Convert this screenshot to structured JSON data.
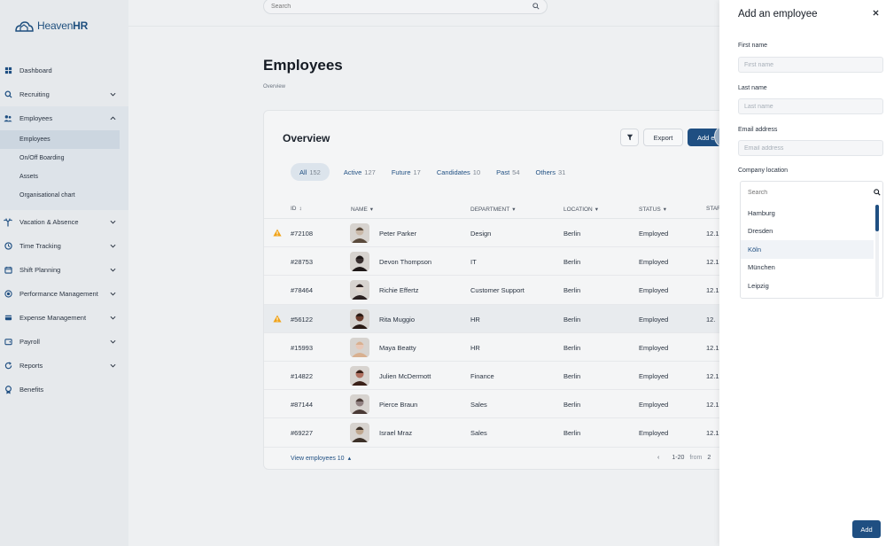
{
  "app": {
    "logo_text_light": "Heaven",
    "logo_text_bold": "HR"
  },
  "search": {
    "placeholder": "Search"
  },
  "sidebar": {
    "items": [
      {
        "label": "Dashboard",
        "icon": "grid-icon",
        "has_chevron": false
      },
      {
        "label": "Recruiting",
        "icon": "magnifier-icon",
        "has_chevron": true
      },
      {
        "label": "Employees",
        "icon": "people-icon",
        "has_chevron": true,
        "open": true
      },
      {
        "label": "Vacation & Absence",
        "icon": "palm-tree-icon",
        "has_chevron": true
      },
      {
        "label": "Time Tracking",
        "icon": "clock-icon",
        "has_chevron": true
      },
      {
        "label": "Shift Planning",
        "icon": "calendar-icon",
        "has_chevron": true
      },
      {
        "label": "Performance Management",
        "icon": "target-icon",
        "has_chevron": true
      },
      {
        "label": "Expense Management",
        "icon": "receipt-icon",
        "has_chevron": true
      },
      {
        "label": "Payroll",
        "icon": "wallet-icon",
        "has_chevron": true
      },
      {
        "label": "Reports",
        "icon": "refresh-icon",
        "has_chevron": true
      },
      {
        "label": "Benefits",
        "icon": "award-icon",
        "has_chevron": false
      }
    ],
    "employees_sub": [
      "Employees",
      "On/Off Boarding",
      "Assets",
      "Organisational chart"
    ]
  },
  "page": {
    "title": "Employees",
    "breadcrumb": "Overview"
  },
  "card": {
    "title": "Overview",
    "export_label": "Export",
    "add_label": "Add e",
    "filters": [
      {
        "label": "All",
        "count": "152",
        "active": true
      },
      {
        "label": "Active",
        "count": "127"
      },
      {
        "label": "Future",
        "count": "17"
      },
      {
        "label": "Candidates",
        "count": "10"
      },
      {
        "label": "Past",
        "count": "54"
      },
      {
        "label": "Others",
        "count": "31"
      }
    ],
    "columns": {
      "id": "ID",
      "name": "NAME",
      "department": "DEPARTMENT",
      "location": "LOCATION",
      "status": "STATUS",
      "start": "STAR"
    },
    "rows": [
      {
        "id": "#72108",
        "name": "Peter Parker",
        "department": "Design",
        "location": "Berlin",
        "status": "Employed",
        "start": "12.1",
        "warning": true
      },
      {
        "id": "#28753",
        "name": "Devon Thompson",
        "department": "IT",
        "location": "Berlin",
        "status": "Employed",
        "start": "12.1"
      },
      {
        "id": "#78464",
        "name": "Richie Effertz",
        "department": "Customer Support",
        "location": "Berlin",
        "status": "Employed",
        "start": "12.1"
      },
      {
        "id": "#56122",
        "name": "Rita Muggio",
        "department": "HR",
        "location": "Berlin",
        "status": "Employed",
        "start": "12.",
        "warning": true,
        "highlight": true
      },
      {
        "id": "#15993",
        "name": "Maya Beatty",
        "department": "HR",
        "location": "Berlin",
        "status": "Employed",
        "start": "12.1"
      },
      {
        "id": "#14822",
        "name": "Julien McDermott",
        "department": "Finance",
        "location": "Berlin",
        "status": "Employed",
        "start": "12.1"
      },
      {
        "id": "#87144",
        "name": "Pierce Braun",
        "department": "Sales",
        "location": "Berlin",
        "status": "Employed",
        "start": "12.1"
      },
      {
        "id": "#69227",
        "name": "Israel Mraz",
        "department": "Sales",
        "location": "Berlin",
        "status": "Employed",
        "start": "12.1"
      }
    ],
    "view_more": "View employees 10",
    "pager_range": "1-20",
    "pager_from": "from",
    "pager_total": "2"
  },
  "drawer": {
    "title": "Add an employee",
    "first_name_label": "First name",
    "first_name_placeholder": "First name",
    "last_name_label": "Last name",
    "last_name_placeholder": "Last name",
    "email_label": "Email address",
    "email_placeholder": "Email address",
    "location_label": "Company location",
    "location_search_placeholder": "Search",
    "location_options": [
      "Hamburg",
      "Dresden",
      "Köln",
      "München",
      "Leipzig"
    ],
    "hover_option": "Köln",
    "add_button": "Add"
  },
  "colors": {
    "accent": "#1f4f82",
    "warning": "#f0a31a"
  }
}
